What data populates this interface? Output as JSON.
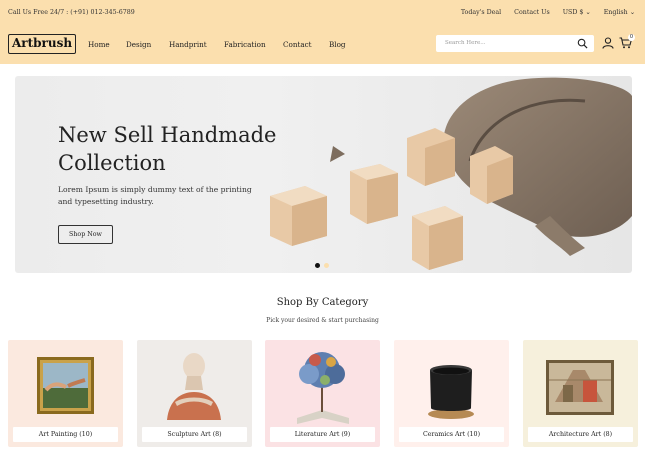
{
  "topbar": {
    "call": "Call Us Free 24/7 : (+91) 012-345-6789",
    "links": [
      "Today's Deal",
      "Contact Us",
      "USD $",
      "English"
    ]
  },
  "brand": {
    "logo": "Artbrush"
  },
  "nav": {
    "items": [
      "Home",
      "Design",
      "Handprint",
      "Fabrication",
      "Contact",
      "Blog"
    ]
  },
  "search": {
    "placeholder": "Search Here..."
  },
  "cart": {
    "count": "0"
  },
  "hero": {
    "title_line1": "New Sell Handmade",
    "title_line2": "Collection",
    "text": "Lorem Ipsum is simply dummy text of the printing and typesetting industry.",
    "button": "Shop Now"
  },
  "category_section": {
    "title": "Shop By Category",
    "subtitle": "Pick your desired & start purchasing"
  },
  "categories": [
    {
      "label": "Art Painting (10)",
      "bg": "#fbe9df"
    },
    {
      "label": "Sculpture Art (8)",
      "bg": "#efece9"
    },
    {
      "label": "Literature Art (9)",
      "bg": "#fbe2e4"
    },
    {
      "label": "Ceramics Art (10)",
      "bg": "#fff0ec"
    },
    {
      "label": "Architecture Art (8)",
      "bg": "#f6f0dc"
    }
  ],
  "colors": {
    "header_bg": "#fbdfae",
    "accent_dot": "#fbdfae"
  }
}
